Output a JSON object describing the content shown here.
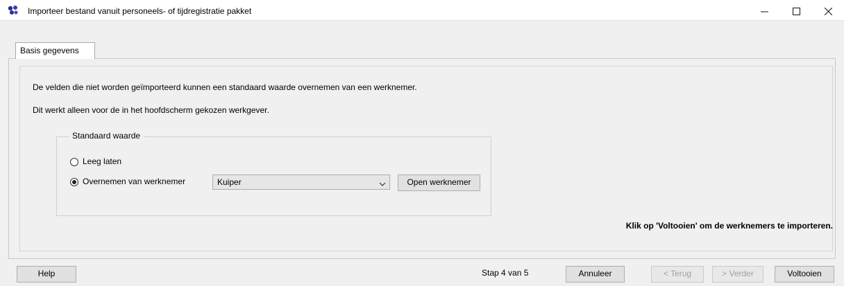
{
  "window": {
    "title": "Importeer bestand vanuit personeels- of tijdregistratie pakket",
    "icon": "app-logo-icon",
    "controls": {
      "minimize": "minimize-icon",
      "maximize": "maximize-icon",
      "close": "close-icon"
    }
  },
  "tabs": [
    {
      "label": "Basis gegevens",
      "active": true
    }
  ],
  "main": {
    "line1": "De velden die niet worden geïmporteerd kunnen een standaard waarde overnemen van een werknemer.",
    "line2": "Dit werkt alleen voor de in het hoofdscherm gekozen werkgever.",
    "group": {
      "legend": "Standaard waarde",
      "options": [
        {
          "label": "Leeg laten",
          "checked": false
        },
        {
          "label": "Overnemen van werknemer",
          "checked": true
        }
      ],
      "select": {
        "value": "Kuiper"
      },
      "open_button": "Open werknemer"
    },
    "finish_hint": "Klik op 'Voltooien' om de werknemers te importeren."
  },
  "footer": {
    "help": "Help",
    "step": "Stap  4 van  5",
    "cancel": "Annuleer",
    "back": "< Terug",
    "next": "> Verder",
    "finish": "Voltooien"
  }
}
